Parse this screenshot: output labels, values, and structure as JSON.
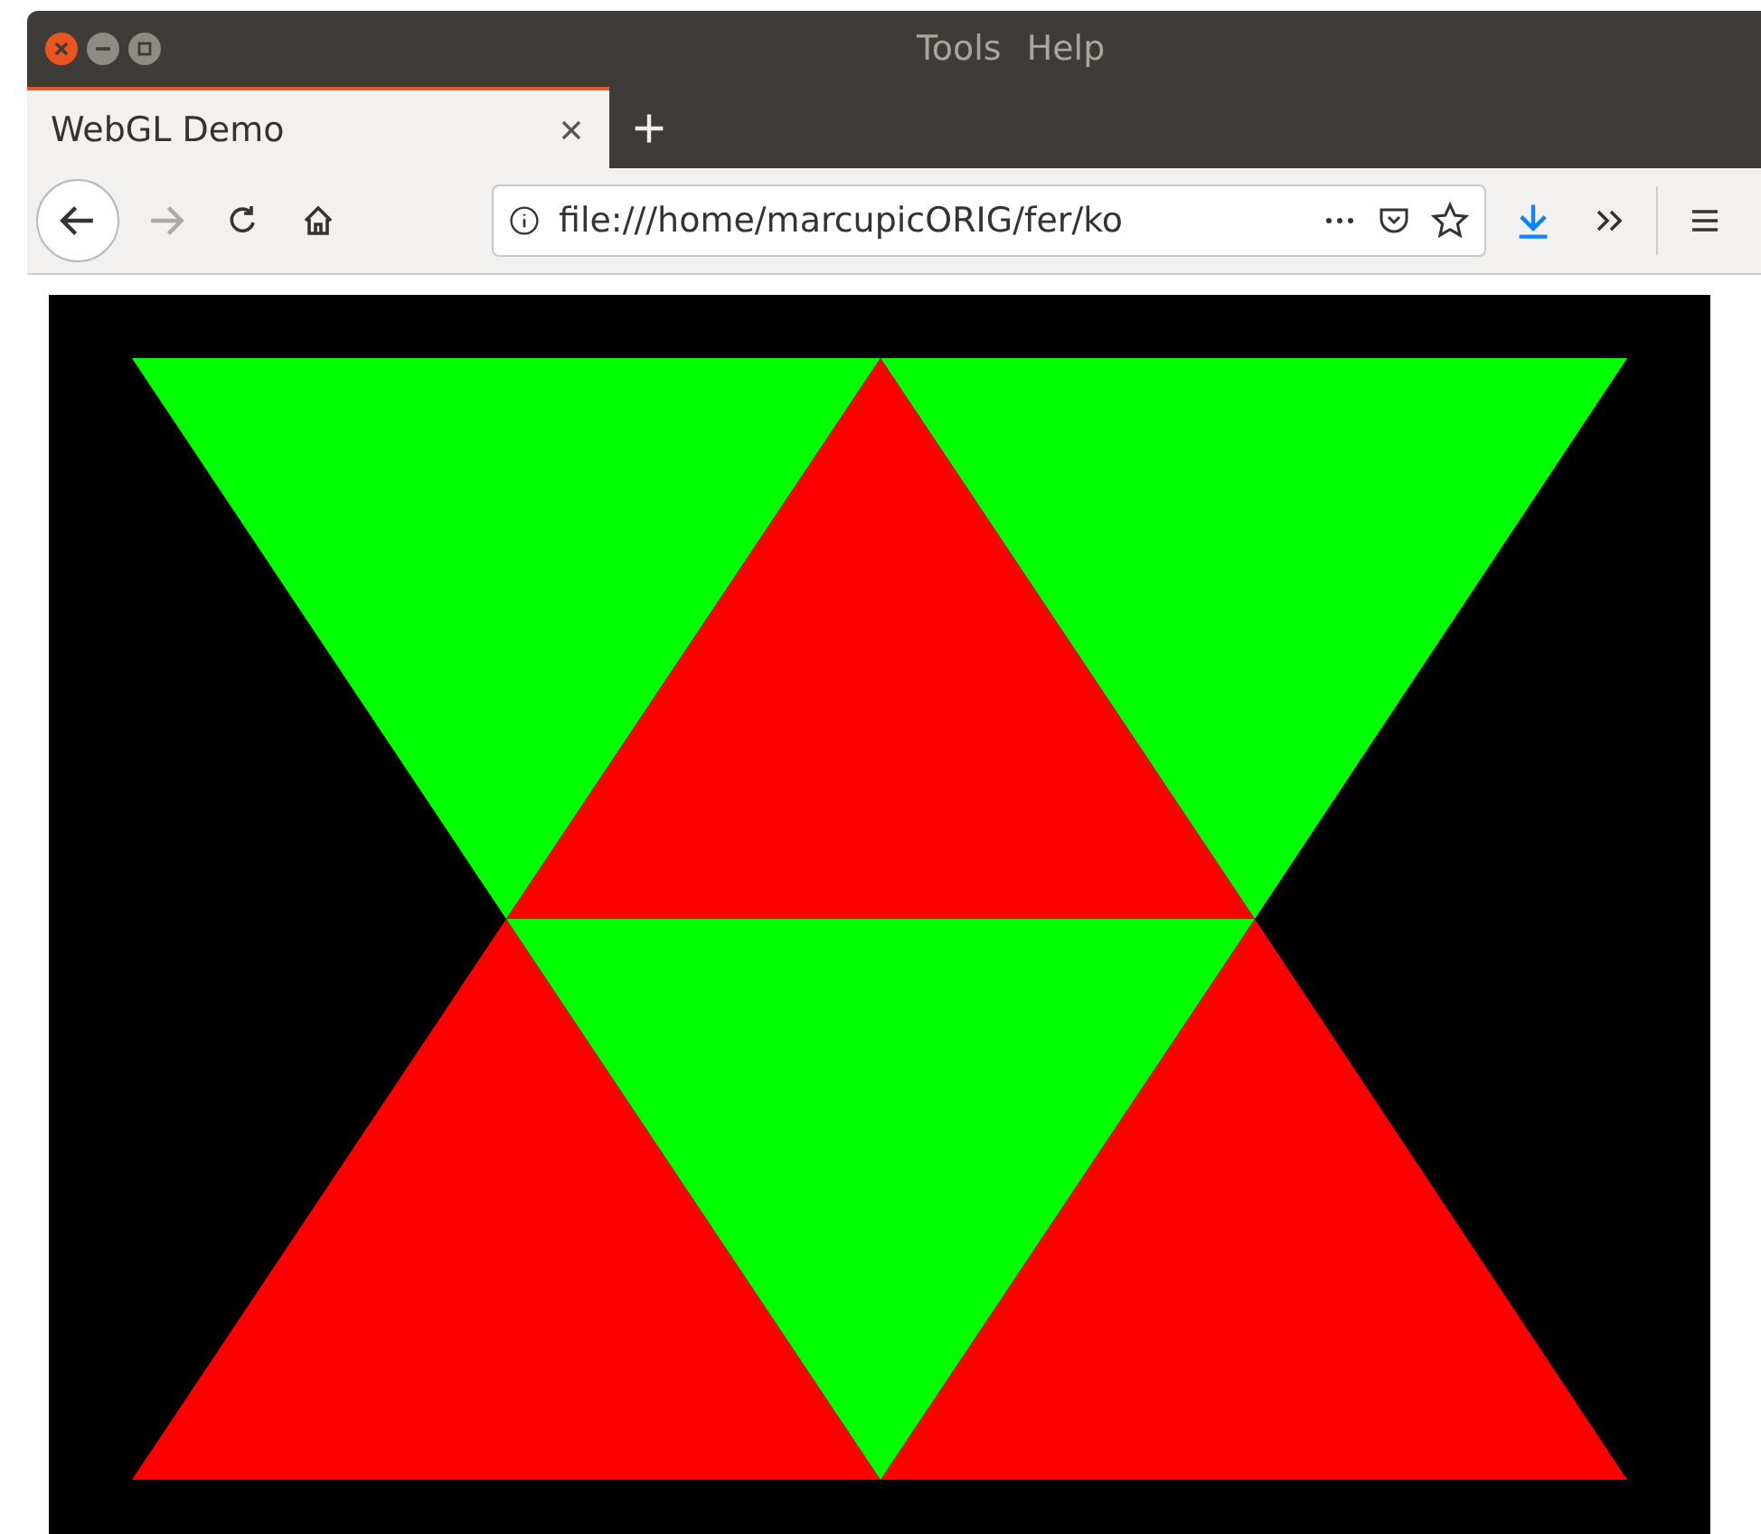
{
  "menu": [
    "Tools",
    "Help"
  ],
  "tabs": [
    {
      "label": "WebGL Demo",
      "selected": true
    }
  ],
  "toolbar": {
    "url": "file:///home/marcupicORIG/fer/ko"
  }
}
